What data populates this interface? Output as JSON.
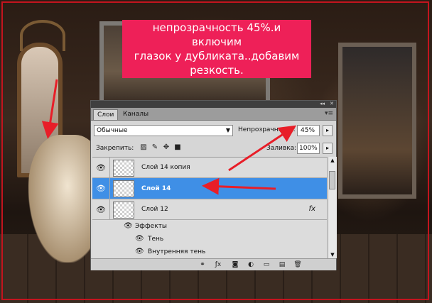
{
  "banner": {
    "text": "непрозрачность 45%.и включим\nглазок у дубликата..добавим\nрезкость."
  },
  "panel": {
    "tabs": [
      {
        "label": "Слои"
      },
      {
        "label": "Каналы"
      }
    ],
    "menu_icon": "panel-menu-icon",
    "blend_mode": "Обычные",
    "opacity_label": "Непрозрачность:",
    "opacity_value": "45%",
    "lock_label": "Закрепить:",
    "fill_label": "Заливка:",
    "fill_value": "100%",
    "layers": [
      {
        "name": "Слой 14 копия",
        "selected": false
      },
      {
        "name": "Слой 14",
        "selected": true
      },
      {
        "name": "Слой 12",
        "selected": false,
        "fx": "fx"
      }
    ],
    "effects": {
      "label": "Эффекты",
      "items": [
        {
          "name": "Тень"
        },
        {
          "name": "Внутренняя тень"
        }
      ]
    }
  },
  "colors": {
    "banner_bg": "#ee2058",
    "selected_layer": "#3f8fe6",
    "arrow": "#e81e28"
  }
}
